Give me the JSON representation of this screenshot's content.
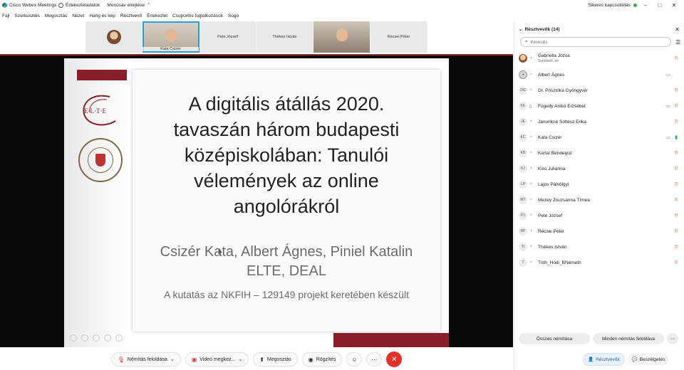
{
  "titlebar": {
    "app_name": "Cisco Webex Meetings",
    "meeting_info": "Értekezletadatok",
    "hide_menu": "Menüsáv elrejtése",
    "connection_status": "Sikeres kapcsolódás",
    "status_color": "#2fb344"
  },
  "menubar": {
    "items": [
      "Fájl",
      "Szerkesztés",
      "Megosztás",
      "Nézet",
      "Hang és kép",
      "Résztvevő",
      "Értekezlet",
      "Csoportos foglalkozások",
      "Súgó"
    ]
  },
  "strip": {
    "tiles": [
      {
        "name": "",
        "kind": "avatar"
      },
      {
        "name": "Kata Csizér",
        "kind": "video"
      },
      {
        "name": "Pete József",
        "kind": "name"
      },
      {
        "name": "Thékes István",
        "kind": "name"
      },
      {
        "name": "",
        "kind": "video"
      },
      {
        "name": "Récsei Péter",
        "kind": "name"
      }
    ]
  },
  "slide": {
    "title_lines": [
      "A digitális átállás 2020.",
      "tavaszán három budapesti",
      "középiskolában: Tanulói",
      "vélemények az online",
      "angolórákról"
    ],
    "authors": "Csizér Kata, Albert Ágnes, Piniel Katalin",
    "affiliation": "ELTE, DEAL",
    "funding": "A kutatás az NKFIH – 129149 projekt keretében készült",
    "elte_logo_text": "E·L·T·E",
    "accent_color": "#8b1e2b"
  },
  "toolbar": {
    "unmute": "Némítás feloldása",
    "video": "Videó megkez...",
    "share": "Megosztás",
    "record": "Rögzítés",
    "reactions_icon": "smiley-icon",
    "more_icon": "more-icon",
    "end_icon": "close-icon"
  },
  "panel": {
    "title": "Résztvevők (14)",
    "search_placeholder": "Keresés",
    "participants": [
      {
        "initials": "",
        "name": "Gabriella Józsa",
        "sub": "Szervező, én",
        "avatar": "photo",
        "cam": "",
        "mic": "muted"
      },
      {
        "initials": "",
        "name": "Albert Ágnes",
        "sub": "",
        "avatar": "person",
        "cam": "camera",
        "mic": ""
      },
      {
        "initials": "DG",
        "name": "Dr. Prisztóka Gyöngyvér",
        "sub": "",
        "avatar": "initials",
        "cam": "",
        "mic": "muted"
      },
      {
        "initials": "FE",
        "name": "Fügedy Anikó Erzsébet",
        "sub": "",
        "avatar": "initials",
        "cam": "camera",
        "mic": "muted"
      },
      {
        "initials": "JE",
        "name": "Janurikné Soltész Erika",
        "sub": "",
        "avatar": "initials",
        "cam": "",
        "mic": "muted"
      },
      {
        "initials": "KC",
        "name": "Kata Csizér",
        "sub": "",
        "avatar": "initials",
        "cam": "camera",
        "mic": "active"
      },
      {
        "initials": "KB",
        "name": "Kertai Bendegúz",
        "sub": "",
        "avatar": "initials",
        "cam": "",
        "mic": "muted"
      },
      {
        "initials": "KJ",
        "name": "Kiss Julianna",
        "sub": "",
        "avatar": "initials",
        "cam": "",
        "mic": "muted"
      },
      {
        "initials": "LP",
        "name": "Lajos Pálvölgyi",
        "sub": "",
        "avatar": "initials",
        "cam": "",
        "mic": "muted"
      },
      {
        "initials": "MT",
        "name": "Mezey Zsuzsanna Tímea",
        "sub": "",
        "avatar": "initials",
        "cam": "",
        "mic": "muted"
      },
      {
        "initials": "PJ",
        "name": "Pete József",
        "sub": "",
        "avatar": "initials",
        "cam": "",
        "mic": "muted"
      },
      {
        "initials": "RP",
        "name": "Récsei Péter",
        "sub": "",
        "avatar": "initials",
        "cam": "",
        "mic": "muted"
      },
      {
        "initials": "TI",
        "name": "Thékes István",
        "sub": "",
        "avatar": "initials",
        "cam": "",
        "mic": "muted"
      },
      {
        "initials": "T",
        "name": "Tóth_Hódi_BNémeth",
        "sub": "",
        "avatar": "initials",
        "cam": "",
        "mic": "muted"
      }
    ],
    "mute_all": "Összes némítása",
    "unmute_all": "Minden némítás feloldása",
    "participants_tab": "Résztvevők",
    "chat_tab": "Beszélgetés"
  }
}
